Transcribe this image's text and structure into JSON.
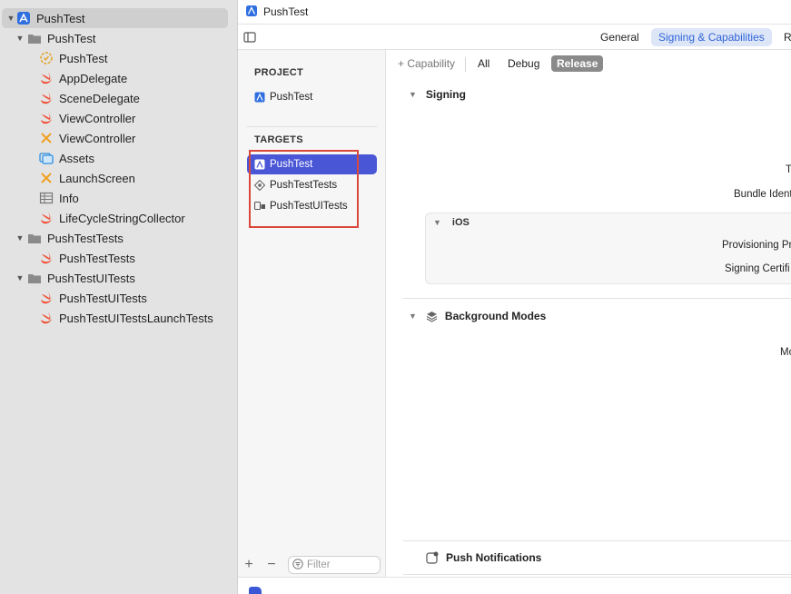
{
  "navigator": {
    "items": [
      {
        "label": "PushTest",
        "kind": "project",
        "icon": "xcode-project-icon"
      },
      {
        "label": "PushTest",
        "kind": "folder",
        "icon": "folder-icon"
      },
      {
        "label": "PushTest",
        "kind": "entitlements",
        "icon": "entitlements-seal-icon"
      },
      {
        "label": "AppDelegate",
        "kind": "swift",
        "icon": "swift-file-icon"
      },
      {
        "label": "SceneDelegate",
        "kind": "swift",
        "icon": "swift-file-icon"
      },
      {
        "label": "ViewController",
        "kind": "swift",
        "icon": "swift-file-icon"
      },
      {
        "label": "ViewController",
        "kind": "storyboard",
        "icon": "storyboard-icon"
      },
      {
        "label": "Assets",
        "kind": "assets",
        "icon": "asset-catalog-icon"
      },
      {
        "label": "LaunchScreen",
        "kind": "storyboard",
        "icon": "storyboard-icon"
      },
      {
        "label": "Info",
        "kind": "plist",
        "icon": "plist-table-icon"
      },
      {
        "label": "LifeCycleStringCollector",
        "kind": "swift",
        "icon": "swift-file-icon"
      },
      {
        "label": "PushTestTests",
        "kind": "folder",
        "icon": "folder-icon"
      },
      {
        "label": "PushTestTests",
        "kind": "swift",
        "icon": "swift-file-icon"
      },
      {
        "label": "PushTestUITests",
        "kind": "folder",
        "icon": "folder-icon"
      },
      {
        "label": "PushTestUITests",
        "kind": "swift",
        "icon": "swift-file-icon"
      },
      {
        "label": "PushTestUITestsLaunchTests",
        "kind": "swift",
        "icon": "swift-file-icon"
      }
    ]
  },
  "titlebar": {
    "title": "PushTest"
  },
  "tabs": {
    "general": "General",
    "signing": "Signing & Capabilities",
    "resource": "Re"
  },
  "targets_panel": {
    "project_header": "PROJECT",
    "project_item": "PushTest",
    "targets_header": "TARGETS",
    "targets": [
      "PushTest",
      "PushTestTests",
      "PushTestUITests"
    ],
    "filter_placeholder": "Filter"
  },
  "capabilities": {
    "add_label": "+ Capability",
    "filters": {
      "all": "All",
      "debug": "Debug",
      "release": "Release"
    },
    "signing": {
      "title": "Signing",
      "field_team": "T",
      "field_bundle": "Bundle Ident",
      "ios_title": "iOS",
      "field_provisioning": "Provisioning Pr",
      "field_certificate": "Signing Certifi"
    },
    "background_modes": {
      "title": "Background Modes",
      "field_modes": "Mo"
    },
    "push": {
      "title": "Push Notifications"
    }
  },
  "colors": {
    "accent": "#4956d6",
    "highlight_box": "#d9483b",
    "active_tab": "#2f63d8"
  }
}
